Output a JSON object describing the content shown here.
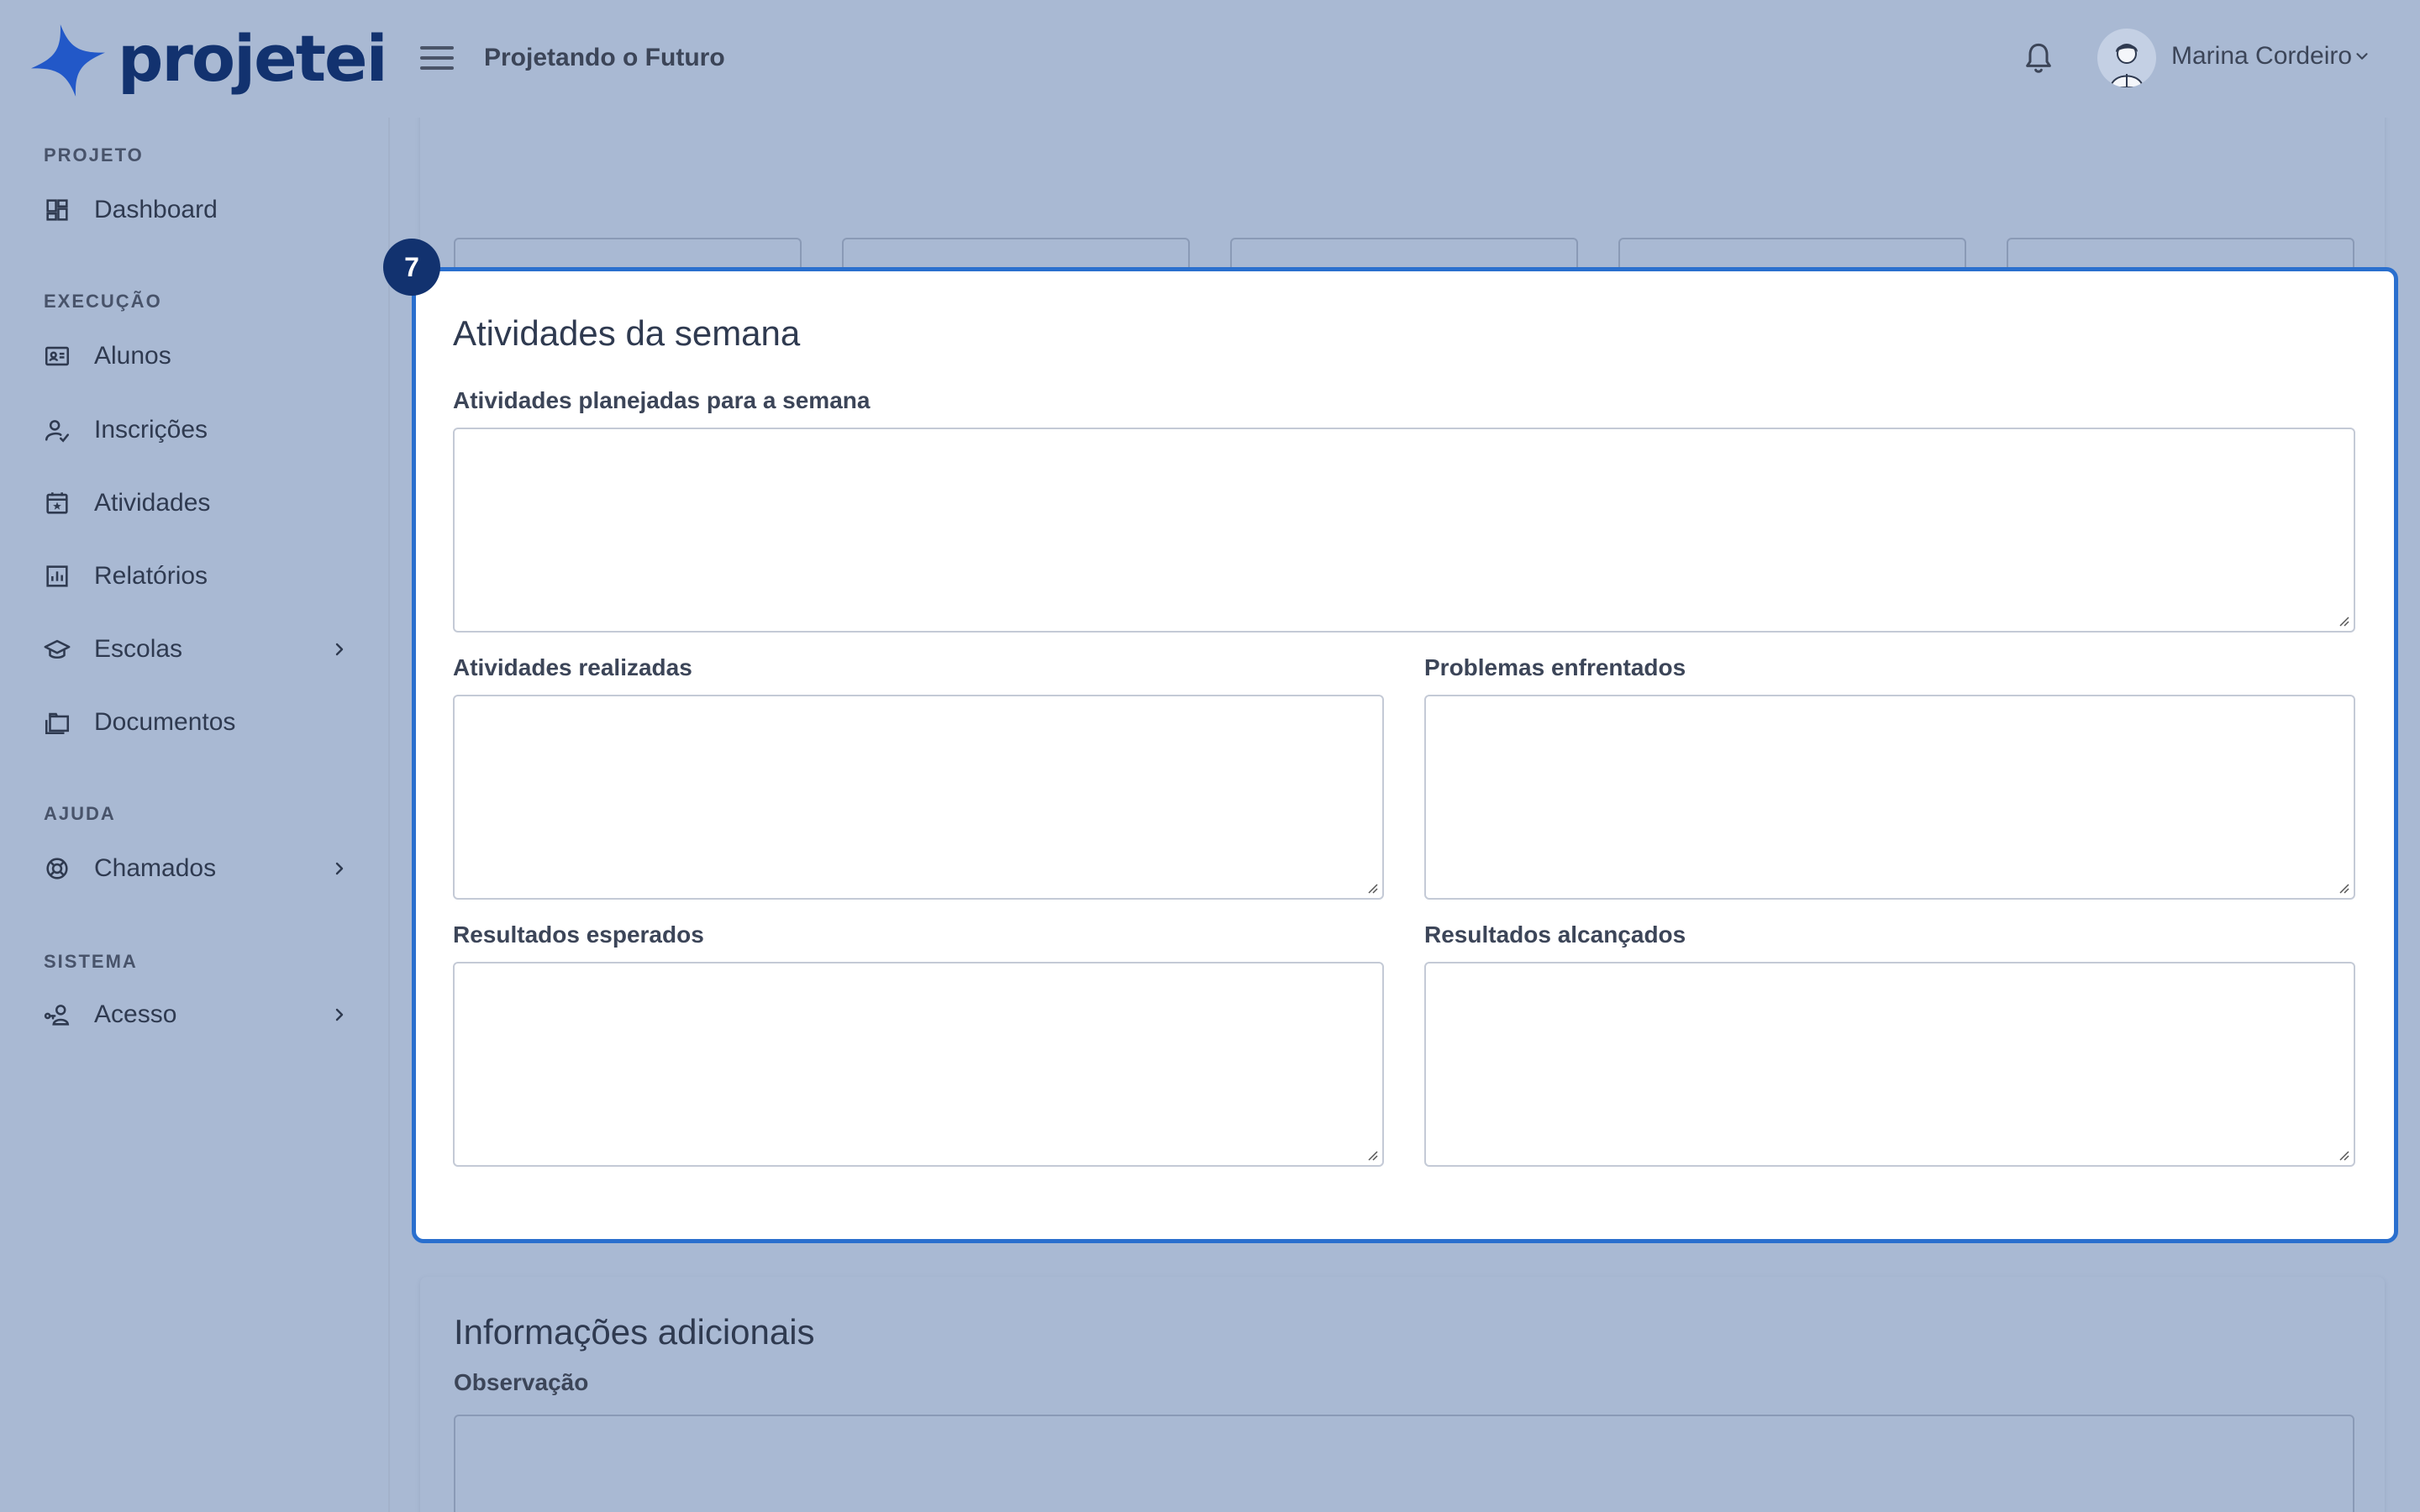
{
  "app": {
    "logo_text": "projetei",
    "project_name": "Projetando o Futuro"
  },
  "user": {
    "name": "Marina Cordeiro"
  },
  "sidebar": {
    "sections": [
      {
        "title": "PROJETO",
        "items": [
          {
            "label": "Dashboard",
            "icon": "dashboard-icon"
          }
        ]
      },
      {
        "title": "EXECUÇÃO",
        "items": [
          {
            "label": "Alunos",
            "icon": "id-card-icon"
          },
          {
            "label": "Inscrições",
            "icon": "user-check-icon"
          },
          {
            "label": "Atividades",
            "icon": "calendar-star-icon"
          },
          {
            "label": "Relatórios",
            "icon": "bar-chart-icon"
          },
          {
            "label": "Escolas",
            "icon": "graduation-cap-icon",
            "expandable": true
          },
          {
            "label": "Documentos",
            "icon": "folders-icon"
          }
        ]
      },
      {
        "title": "AJUDA",
        "items": [
          {
            "label": "Chamados",
            "icon": "lifebuoy-icon",
            "expandable": true
          }
        ]
      },
      {
        "title": "SISTEMA",
        "items": [
          {
            "label": "Acesso",
            "icon": "user-key-icon",
            "expandable": true
          }
        ]
      }
    ]
  },
  "step": {
    "number": "7"
  },
  "weekly": {
    "title": "Atividades da semana",
    "planned_label": "Atividades planejadas para a semana",
    "done_label": "Atividades realizadas",
    "problems_label": "Problemas enfrentados",
    "expected_label": "Resultados esperados",
    "achieved_label": "Resultados alcançados"
  },
  "additional": {
    "title": "Informações adicionais",
    "observation_label": "Observação"
  }
}
